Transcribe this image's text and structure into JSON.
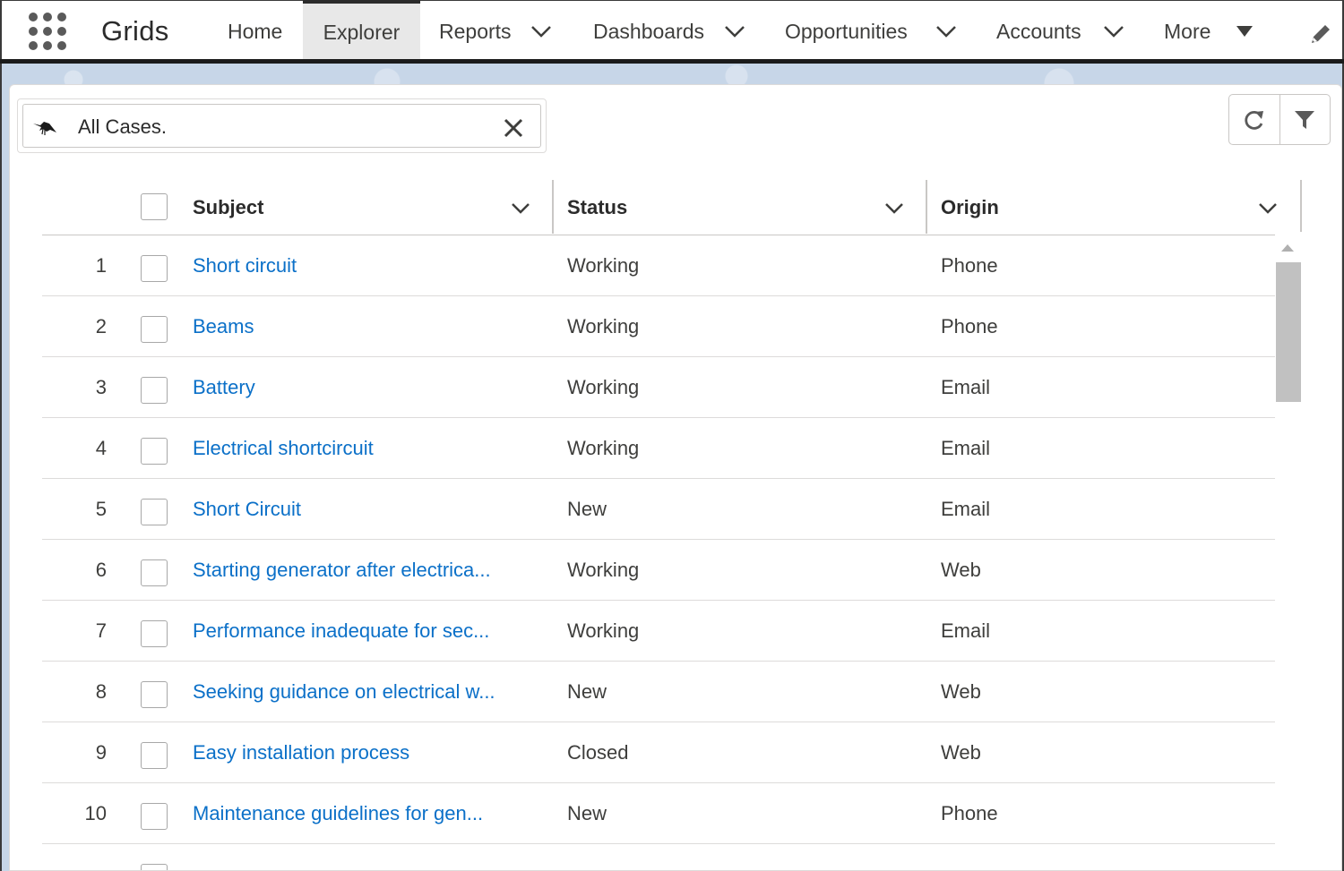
{
  "app": {
    "name": "Grids",
    "launcher_icon": "app-launcher-dots-icon"
  },
  "nav": {
    "items": [
      {
        "label": "Home",
        "dropdown": false
      },
      {
        "label": "Explorer",
        "dropdown": false,
        "active": true
      },
      {
        "label": "Reports",
        "dropdown": true
      },
      {
        "label": "Dashboards",
        "dropdown": true
      },
      {
        "label": "Opportunities",
        "dropdown": true
      },
      {
        "label": "Accounts",
        "dropdown": true
      },
      {
        "label": "More",
        "dropdown": true
      }
    ],
    "edit_icon": "pencil-icon"
  },
  "list_view": {
    "name": "All Cases.",
    "icon": "crow-icon",
    "clear_icon": "close-icon"
  },
  "toolbar": {
    "refresh_icon": "refresh-icon",
    "filter_icon": "filter-icon"
  },
  "grid": {
    "columns": [
      {
        "label": "Subject"
      },
      {
        "label": "Status"
      },
      {
        "label": "Origin"
      }
    ],
    "rows": [
      {
        "num": "1",
        "subject": "Short circuit",
        "status": "Working",
        "origin": "Phone"
      },
      {
        "num": "2",
        "subject": "Beams",
        "status": "Working",
        "origin": "Phone"
      },
      {
        "num": "3",
        "subject": "Battery",
        "status": "Working",
        "origin": "Email"
      },
      {
        "num": "4",
        "subject": "Electrical shortcircuit",
        "status": "Working",
        "origin": "Email"
      },
      {
        "num": "5",
        "subject": "Short Circuit",
        "status": "New",
        "origin": "Email"
      },
      {
        "num": "6",
        "subject": "Starting generator after electrica...",
        "status": "Working",
        "origin": "Web"
      },
      {
        "num": "7",
        "subject": "Performance inadequate for sec...",
        "status": "Working",
        "origin": "Email"
      },
      {
        "num": "8",
        "subject": "Seeking guidance on electrical w...",
        "status": "New",
        "origin": "Web"
      },
      {
        "num": "9",
        "subject": "Easy installation process",
        "status": "Closed",
        "origin": "Web"
      },
      {
        "num": "10",
        "subject": "Maintenance guidelines for gen...",
        "status": "New",
        "origin": "Phone"
      }
    ]
  },
  "colors": {
    "link": "#0b70c8",
    "active_tab_bg": "#e8e8e8",
    "band": "#c7d6e8"
  }
}
